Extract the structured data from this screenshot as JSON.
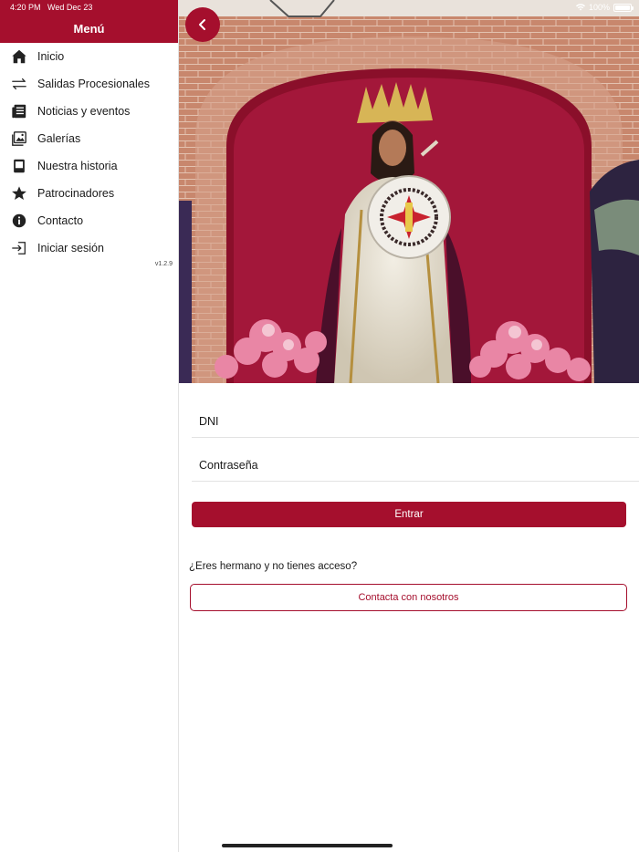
{
  "status_bar": {
    "time": "4:20 PM",
    "date": "Wed Dec 23",
    "battery": "100%"
  },
  "sidebar": {
    "title": "Menú",
    "version": "v1.2.9",
    "items": [
      {
        "label": "Inicio",
        "icon": "home-icon"
      },
      {
        "label": "Salidas Procesionales",
        "icon": "arrows-exchange-icon"
      },
      {
        "label": "Noticias y eventos",
        "icon": "newspaper-icon"
      },
      {
        "label": "Galerías",
        "icon": "gallery-icon"
      },
      {
        "label": "Nuestra historia",
        "icon": "book-icon"
      },
      {
        "label": "Patrocinadores",
        "icon": "star-icon"
      },
      {
        "label": "Contacto",
        "icon": "info-icon"
      },
      {
        "label": "Iniciar sesión",
        "icon": "login-icon"
      }
    ]
  },
  "login": {
    "dni_placeholder": "DNI",
    "password_placeholder": "Contraseña",
    "submit_label": "Entrar",
    "no_access_text": "¿Eres hermano y no tienes acceso?",
    "contact_label": "Contacta con nosotros"
  },
  "colors": {
    "brand": "#a50f2d",
    "background": "#ffffff"
  }
}
